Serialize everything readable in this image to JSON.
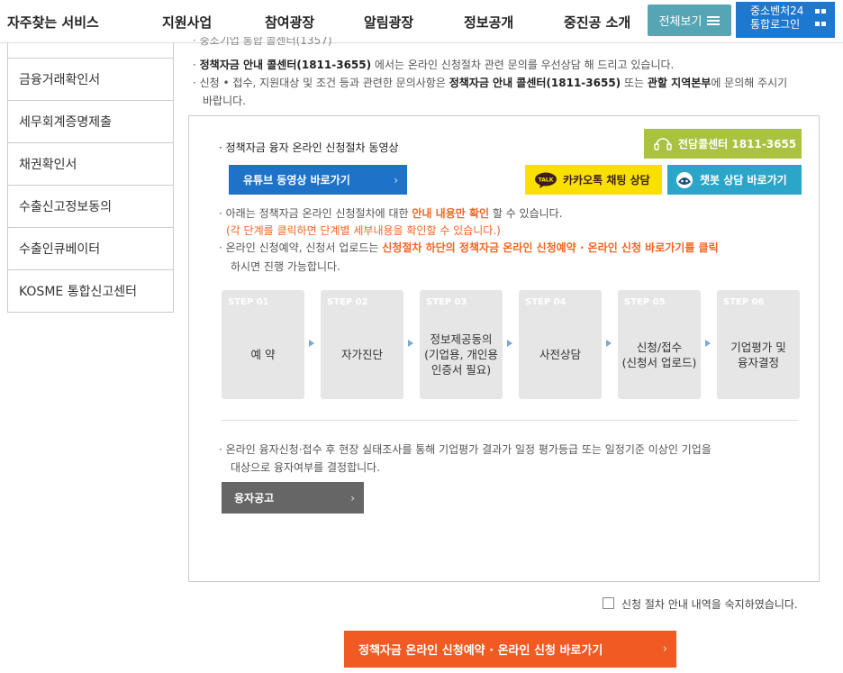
{
  "nav": {
    "items": [
      "자주찾는 서비스",
      "지원사업",
      "참여광장",
      "알림광장",
      "정보공개",
      "중진공 소개"
    ],
    "all_menu": "전체보기",
    "login_line1": "중소벤처24",
    "login_line2": "통합로그인"
  },
  "sidebar": {
    "items": [
      "금융거래확인서",
      "세무회계증명제출",
      "채권확인서",
      "수출신고정보동의",
      "수출인큐베이터",
      "KOSME 통합신고센터"
    ]
  },
  "notes": {
    "cut_line": "· 중소기업 통합 콜센터(1357)",
    "line1_bold": "정책자금 안내 콜센터(1811-3655)",
    "line1_rest": " 에서는 온라인 신청절차 관련 문의를 우선상담 해 드리고 있습니다.",
    "line2_a": "· 신청 • 접수, 지원대상 및 조건 등과 관련한 문의사항은 ",
    "line2_bold1": "정책자금 안내 콜센터(1811-3655)",
    "line2_b": " 또는 ",
    "line2_bold2": "관할 지역본부",
    "line2_c": "에 문의해 주시기",
    "line3": "바랍니다."
  },
  "panel": {
    "video_title": "· 정책자금 융자 온라인 신청절차 동영상",
    "youtube_btn": "유튜브 동영상 바로가기",
    "callcenter_btn": "전담콜센터 1811-3655",
    "kakao_btn": "카카오톡 채팅 상담",
    "chatbot_btn": "챗봇 상담 바로가기",
    "info1_a": "· 아래는 정책자금 온라인 신청절차에 대한 ",
    "info1_hl": "안내 내용만 확인",
    "info1_b": " 할 수 있습니다.",
    "info2": "(각 단계를 클릭하면 단계별 세부내용을 확인할 수 있습니다.)",
    "info3_a": "· 온라인 신청예약, 신청서 업로드는 ",
    "info3_hl": "신청절차 하단의 정책자금 온라인 신청예약 · 온라인 신청 바로가기를 클릭",
    "info4": "하시면 진행 가능합니다.",
    "steps": [
      {
        "num": "STEP 01",
        "label": "예    약"
      },
      {
        "num": "STEP 02",
        "label": "자가진단"
      },
      {
        "num": "STEP 03",
        "label": "정보제공동의\n(기업용, 개인용\n인증서 필요)"
      },
      {
        "num": "STEP 04",
        "label": "사전상담"
      },
      {
        "num": "STEP 05",
        "label": "신청/접수\n(신청서 업로드)"
      },
      {
        "num": "STEP 06",
        "label": "기업평가 및\n융자결정"
      }
    ],
    "bottom1": "· 온라인 융자신청·접수 후 현장 실태조사를 통해 기업평가 결과가 일정 평가등급 또는 일정기준 이상인 기업을",
    "bottom2": "대상으로 융자여부를 결정합니다.",
    "loan_notice_btn": "융자공고"
  },
  "consent_label": "신청 절차 안내 내역을 숙지하였습니다.",
  "apply_btn": "정책자금 온라인 신청예약 · 온라인 신청 바로가기",
  "colors": {
    "youtube": "#1e73c8",
    "callcenter": "#a9c23f",
    "kakao": "#f9e000",
    "chatbot": "#2ca6c8",
    "loan_notice": "#666666",
    "apply": "#f15a22",
    "highlight": "#f26522"
  }
}
